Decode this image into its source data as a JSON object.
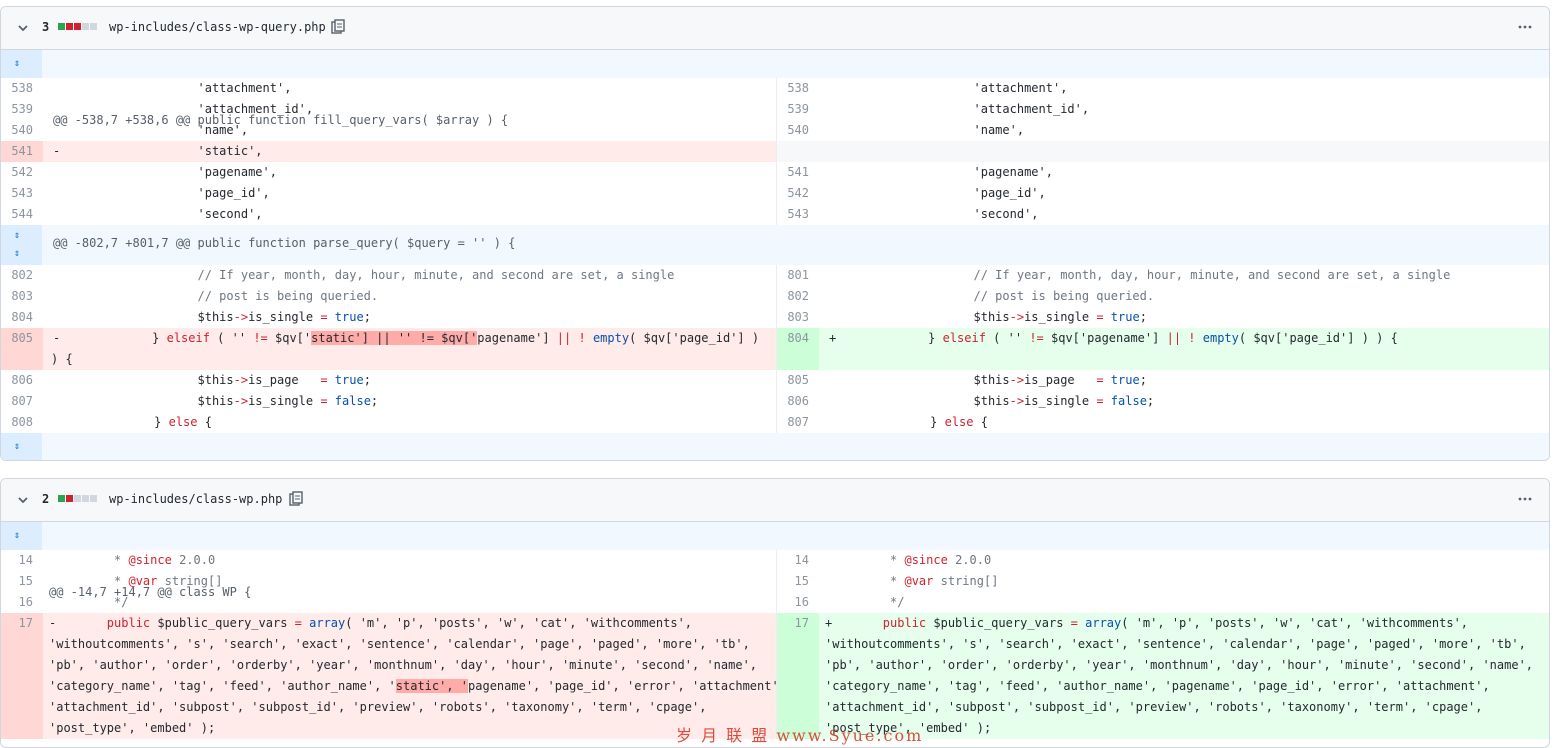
{
  "file1": {
    "count": "3",
    "path": "wp-includes/class-wp-query.php",
    "blocks": [
      "#2da44e",
      "#cf222e",
      "#cf222e",
      "#d0d7de",
      "#d0d7de"
    ],
    "hunk1": "@@ -538,7 +538,6 @@ public function fill_query_vars( $array ) {",
    "hunk2": "@@ -802,7 +801,7 @@ public function parse_query( $query = '' ) {",
    "rows_a": [
      {
        "l": "538",
        "r": "538",
        "code": "                    'attachment',"
      },
      {
        "l": "539",
        "r": "539",
        "code": "                    'attachment_id',"
      },
      {
        "l": "540",
        "r": "540",
        "code": "                    'name',"
      }
    ],
    "del_541": {
      "l": "541",
      "sign": "-",
      "code": "                    'static',"
    },
    "rows_b": [
      {
        "l": "542",
        "r": "541",
        "code": "                    'pagename',"
      },
      {
        "l": "543",
        "r": "542",
        "code": "                    'page_id',"
      },
      {
        "l": "544",
        "r": "543",
        "code": "                    'second',"
      }
    ],
    "rows_c": [
      {
        "l": "802",
        "r": "801",
        "code": "                    // If year, month, day, hour, minute, and second are set, a single"
      },
      {
        "l": "803",
        "r": "802",
        "code": "                    // post is being queried."
      }
    ],
    "row_804": {
      "l": "804",
      "r": "803"
    },
    "change_805": {
      "l": "805",
      "r": "804",
      "lsign": "-",
      "rsign": "+"
    },
    "rows_d": [
      {
        "l": "806",
        "r": "805"
      },
      {
        "l": "807",
        "r": "806"
      },
      {
        "l": "808",
        "r": "807"
      }
    ]
  },
  "file2": {
    "count": "2",
    "path": "wp-includes/class-wp.php",
    "blocks": [
      "#2da44e",
      "#cf222e",
      "#d0d7de",
      "#d0d7de",
      "#d0d7de"
    ],
    "hunk1": "@@ -14,7 +14,7 @@ class WP {",
    "rows": [
      {
        "l": "14",
        "r": "14",
        "pre": "         * ",
        "tag": "@since",
        "post": " 2.0.0"
      },
      {
        "l": "15",
        "r": "15",
        "pre": "         * ",
        "tag": "@var",
        "post": " string[]"
      },
      {
        "l": "16",
        "r": "16",
        "pre": "         */",
        "tag": "",
        "post": ""
      }
    ],
    "change_17": {
      "l": "17",
      "r": "17",
      "lsign": "-",
      "rsign": "+"
    }
  },
  "watermark": "岁 月 联 盟   www.Syue.com",
  "icons": {
    "collapse": "chevron-down-icon",
    "copy": "copy-icon",
    "more": "kebab-horizontal-icon",
    "expand": "unfold-icon"
  }
}
